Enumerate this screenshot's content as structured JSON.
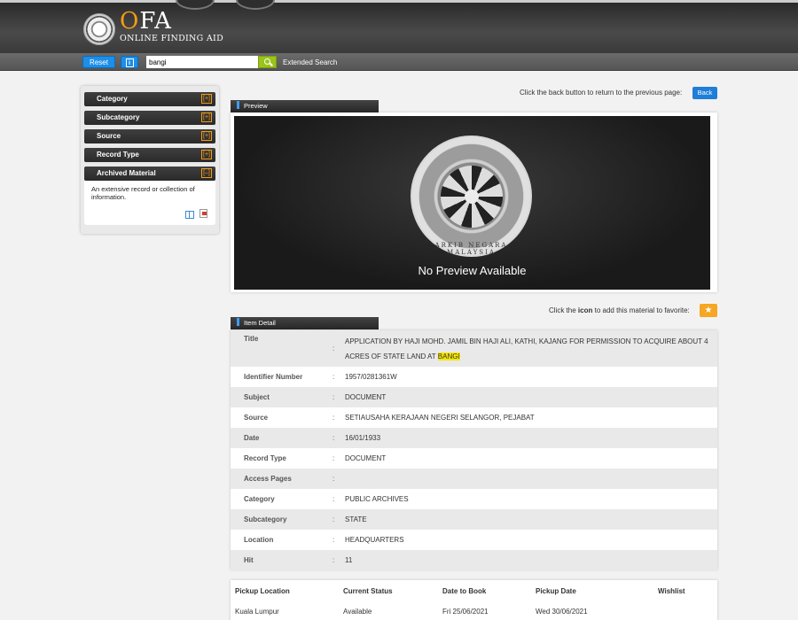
{
  "header": {
    "logo_big": "FA",
    "logo_o": "O",
    "logo_small": "ONLINE FINDING AID"
  },
  "searchbar": {
    "reset_label": "Reset",
    "info_label": "i",
    "query": "bangi",
    "extended_label": "Extended Search"
  },
  "sidebar": {
    "facets": [
      {
        "label": "Category",
        "toggle": "[+]"
      },
      {
        "label": "Subcategory",
        "toggle": "[+]"
      },
      {
        "label": "Source",
        "toggle": "[+]"
      },
      {
        "label": "Record Type",
        "toggle": "[+]"
      },
      {
        "label": "Archived Material",
        "toggle": "[–]"
      }
    ],
    "archived_desc": "An extensive record or collection of information."
  },
  "main": {
    "back_text": "Click the back button to return to the previous page:",
    "back_label": "Back",
    "preview_title": "Preview",
    "seal_text": "ARKIB NEGARA MALAYSIA",
    "no_preview": "No Preview Available",
    "fav_pre": "Click the",
    "fav_icon_word": "icon",
    "fav_post": "to add this material to favorite:",
    "fav_star": "★",
    "detail_title": "Item Detail"
  },
  "detail": {
    "title_label": "Title",
    "title_value_pre": "APPLICATION BY HAJI MOHD. JAMIL BIN HAJI ALI, KATHI, KAJANG FOR PERMISSION TO ACQUIRE ABOUT 4 ACRES OF STATE LAND AT",
    "title_value_hl": "BANGI",
    "rows": [
      {
        "label": "Identifier Number",
        "value": "1957/0281361W"
      },
      {
        "label": "Subject",
        "value": "DOCUMENT"
      },
      {
        "label": "Source",
        "value": "SETIAUSAHA KERAJAAN NEGERI SELANGOR, PEJABAT"
      },
      {
        "label": "Date",
        "value": "16/01/1933"
      },
      {
        "label": "Record Type",
        "value": "DOCUMENT"
      },
      {
        "label": "Access Pages",
        "value": ""
      },
      {
        "label": "Category",
        "value": "PUBLIC ARCHIVES"
      },
      {
        "label": "Subcategory",
        "value": "STATE"
      },
      {
        "label": "Location",
        "value": "HEADQUARTERS"
      },
      {
        "label": "Hit",
        "value": "11"
      }
    ],
    "colon": ":"
  },
  "pickup": {
    "headers": [
      "Pickup Location",
      "Current Status",
      "Date to Book",
      "Pickup Date",
      "Wishlist"
    ],
    "row": [
      "Kuala Lumpur",
      "Available",
      "Fri 25/06/2021",
      "Wed 30/06/2021",
      ""
    ]
  }
}
